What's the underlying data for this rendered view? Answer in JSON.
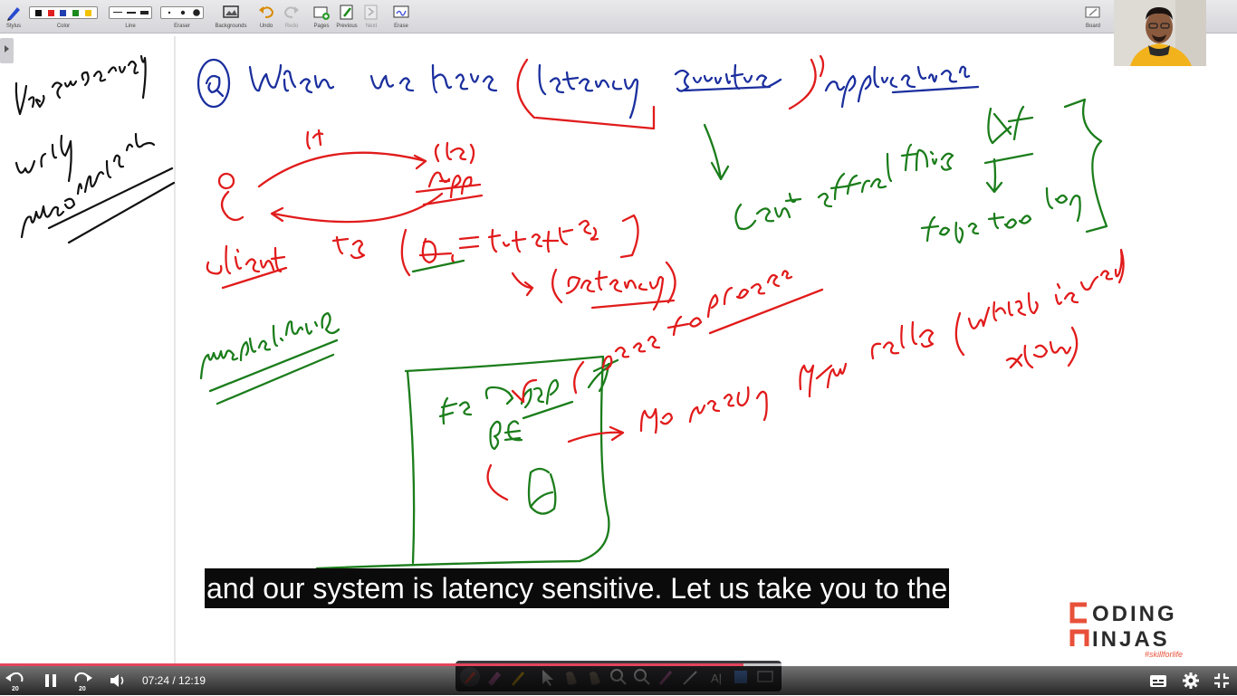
{
  "toolbar": {
    "tools": [
      {
        "label": "Stylus"
      },
      {
        "label": "Color"
      },
      {
        "label": "Line"
      },
      {
        "label": "Eraser"
      },
      {
        "label": "Backgrounds"
      },
      {
        "label": "Undo"
      },
      {
        "label": "Redo"
      },
      {
        "label": "Pages"
      },
      {
        "label": "Previous"
      },
      {
        "label": "Next"
      },
      {
        "label": "Erase"
      }
    ],
    "board_label": "Board",
    "colors": [
      "#111111",
      "#e02020",
      "#1f3fb0",
      "#1c8a1c",
      "#f2c200"
    ]
  },
  "caption": {
    "text": "and our system is latency sensitive. Let us take you to the"
  },
  "logo": {
    "line1": "CODING",
    "line2": "NINJAS",
    "tagline": "#skillforlife",
    "accent": "#e8503a"
  },
  "player": {
    "current_time": "07:24",
    "duration": "12:19",
    "time_display": "07:24 / 12:19",
    "progress_fraction": 0.601,
    "buffered_fraction": 0.764,
    "skip_seconds": "20",
    "played_color": "#e3455c"
  },
  "ink": {
    "blue": "#1b2f9e",
    "red": "#e11b1b",
    "green": "#1b7d1b",
    "black": "#111111"
  }
}
